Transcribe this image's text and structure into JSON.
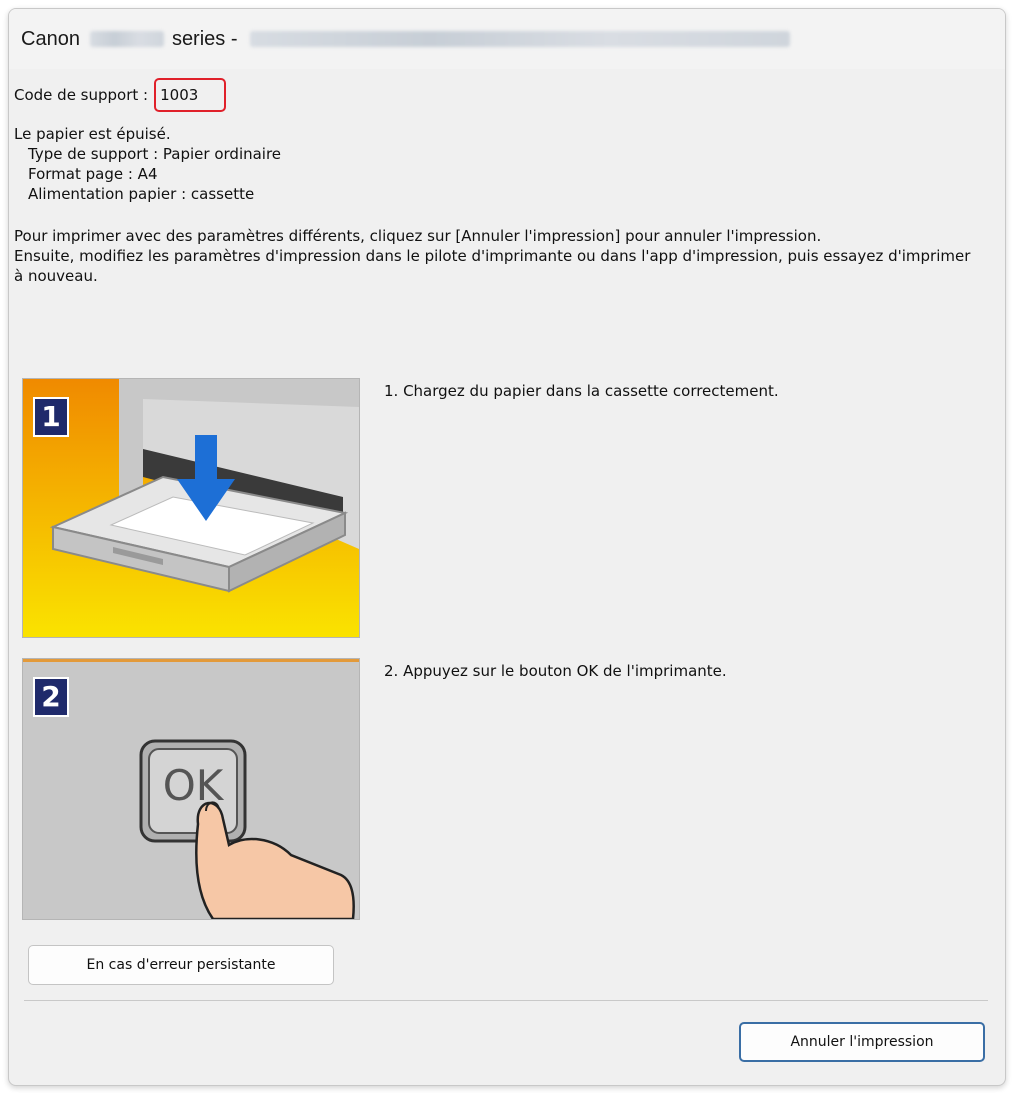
{
  "window": {
    "title_prefix": "Canon",
    "title_series": "series -"
  },
  "error": {
    "code_label": "Code de support :",
    "code_value": "1003",
    "status_title": "Le papier est épuisé.",
    "details": [
      "Type de support : Papier ordinaire",
      "Format page : A4",
      "Alimentation papier : cassette"
    ],
    "instructions": [
      "Pour imprimer avec des paramètres différents, cliquez sur [Annuler l'impression] pour annuler l'impression.",
      "Ensuite, modifiez les paramètres d'impression dans le pilote d'imprimante ou dans l'app d'impression, puis essayez d'imprimer à nouveau."
    ]
  },
  "steps": [
    {
      "number": "1",
      "text": "1.  Chargez du papier dans la cassette correctement."
    },
    {
      "number": "2",
      "text": "2.  Appuyez sur le bouton OK de l'imprimante.",
      "button_label": "OK"
    }
  ],
  "buttons": {
    "persistent_error": "En cas d'erreur persistante",
    "cancel_print": "Annuler l'impression"
  },
  "colors": {
    "highlight_border": "#e0202a",
    "step_badge": "#1f2a6b",
    "cassette_background": "#f6b800",
    "arrow": "#1d6fd6"
  }
}
